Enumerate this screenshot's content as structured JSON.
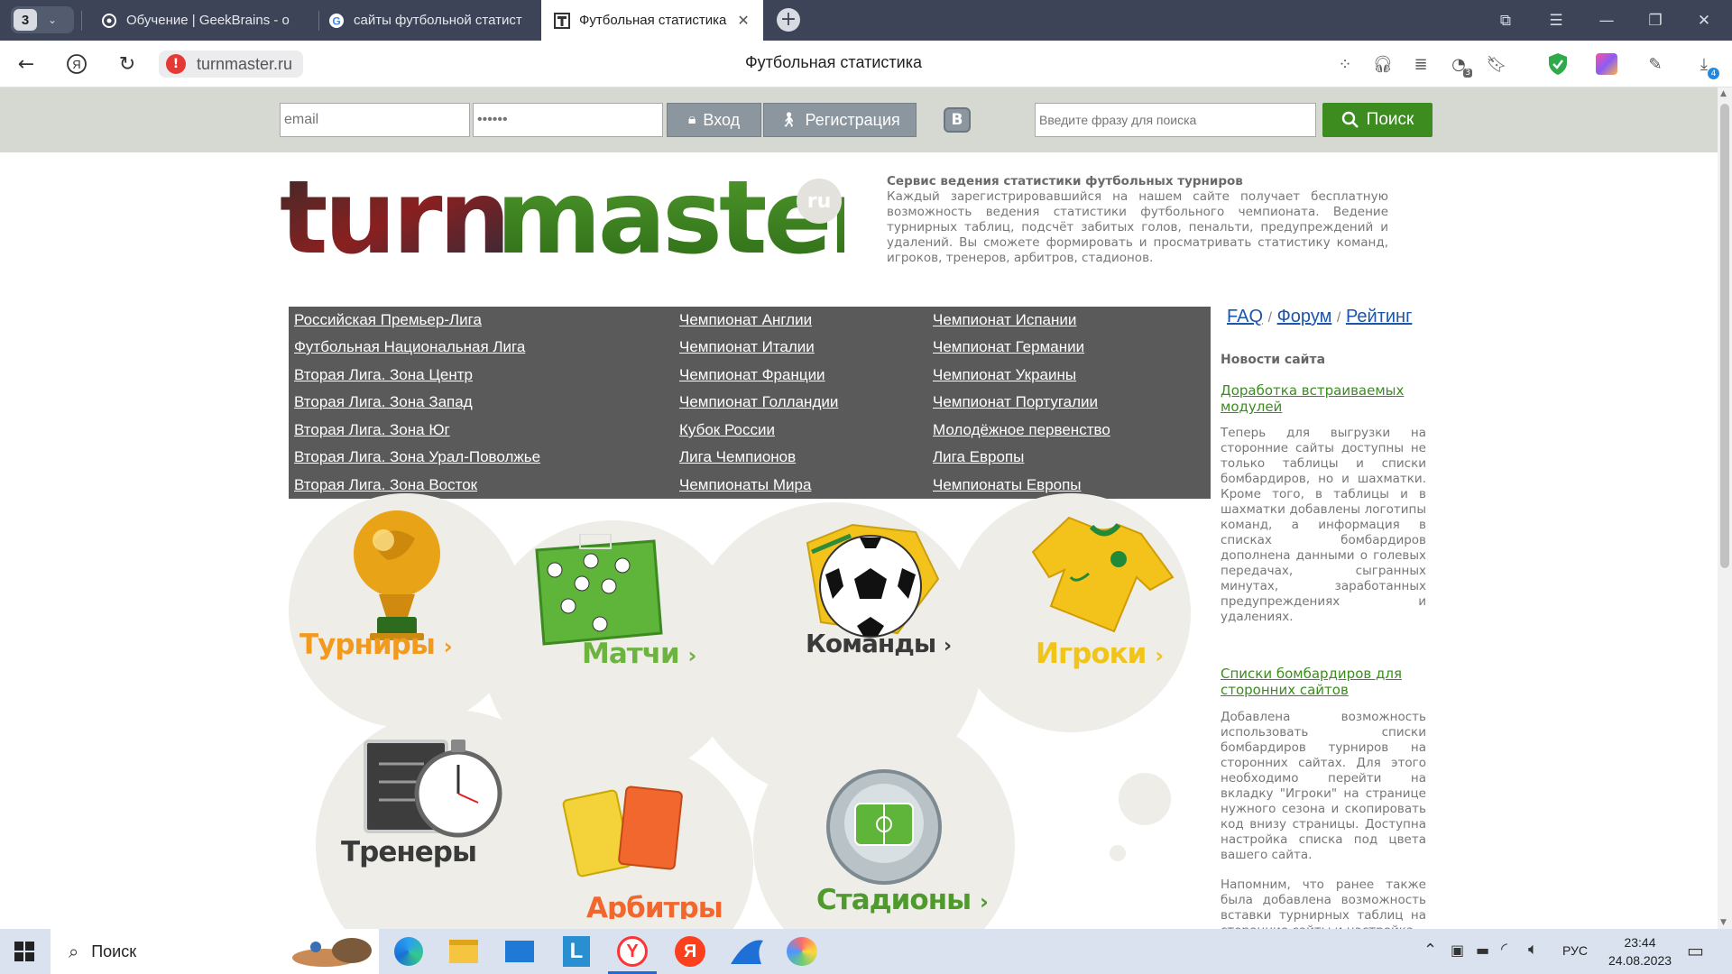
{
  "browser": {
    "tab_count": "3",
    "tabs": [
      {
        "title": "Обучение | GeekBrains - о"
      },
      {
        "title": "сайты футбольной статист"
      },
      {
        "title": "Футбольная статистика"
      }
    ],
    "url": "turnmaster.ru",
    "page_title": "Футбольная статистика",
    "downloads_badge": "4",
    "notif_badge": "3"
  },
  "header": {
    "email_placeholder": "email",
    "password_placeholder": "••••••",
    "login_label": "Вход",
    "register_label": "Регистрация",
    "vk_label": "B",
    "search_placeholder": "Введите фразу для поиска",
    "search_label": "Поиск"
  },
  "logo": {
    "text": "turnmaster",
    "badge": "ru"
  },
  "intro": {
    "title": "Сервис ведения статистики футбольных турниров",
    "text": "Каждый зарегистрировавшийся на нашем сайте получает бесплатную возможность ведения статистики футбольного чемпионата. Ведение турнирных таблиц, подсчёт забитых голов, пенальти, предупреждений и удалений. Вы сможете формировать и просматривать статистику команд, игроков, тренеров, арбитров, стадионов."
  },
  "leagues": {
    "col1": [
      "Российская Премьер-Лига",
      "Футбольная Национальная Лига",
      "Вторая Лига. Зона Центр",
      "Вторая Лига. Зона Запад",
      "Вторая Лига. Зона Юг",
      "Вторая Лига. Зона Урал-Поволжье",
      "Вторая Лига. Зона Восток"
    ],
    "col2": [
      "Чемпионат Англии",
      "Чемпионат Италии",
      "Чемпионат Франции",
      "Чемпионат Голландии",
      "Кубок России",
      "Лига Чемпионов",
      "Чемпионаты Мира"
    ],
    "col3": [
      "Чемпионат Испании",
      "Чемпионат Германии",
      "Чемпионат Украины",
      "Чемпионат Португалии",
      "Молодёжное первенство",
      "Лига Европы",
      "Чемпионаты Европы"
    ]
  },
  "sidebar": {
    "faq": "FAQ",
    "forum": "Форум",
    "rating": "Рейтинг",
    "sep": "/",
    "news_heading": "Новости сайта",
    "news": [
      {
        "title": "Доработка встраиваемых модулей",
        "text": "Теперь для выгрузки на сторонние сайты доступны не только таблицы и списки бомбардиров, но и шахматки. Кроме того, в таблицы и в шахматки добавлены логотипы команд, а информация в списках бомбардиров дополнена данными о голевых передачах, сыгранных минутах, заработанных предупреждениях и удалениях."
      },
      {
        "title": "Списки бомбардиров для сторонних сайтов",
        "text": "Добавлена возможность использовать списки бомбардиров турниров на сторонних сайтах. Для этого необходимо перейти на вкладку \"Игроки\" на странице нужного сезона и скопировать код внизу страницы. Доступна настройка списка под цвета вашего сайта.",
        "text2": "Напомним, что ранее также была добавлена возможность вставки турнирных таблиц на сторонние сайты и настройка"
      }
    ]
  },
  "tiles": {
    "tournaments": "Турниры",
    "matches": "Матчи",
    "teams": "Команды",
    "players": "Игроки",
    "coaches": "Тренеры",
    "referees": "Арбитры",
    "stadiums": "Стадионы",
    "arrow": "›"
  },
  "taskbar": {
    "search_label": "Поиск",
    "lang": "РУС",
    "time": "23:44",
    "date": "24.08.2023"
  },
  "colors": {
    "tab_bar": "#3d4458",
    "league_bg": "#5a5a5a",
    "search_green": "#3c8c1f",
    "link_blue": "#1d55a8",
    "tournaments_orange": "#f29a1d",
    "matches_green": "#6db33f",
    "teams_dark": "#3a3a3a",
    "players_yellow": "#f0c419"
  }
}
